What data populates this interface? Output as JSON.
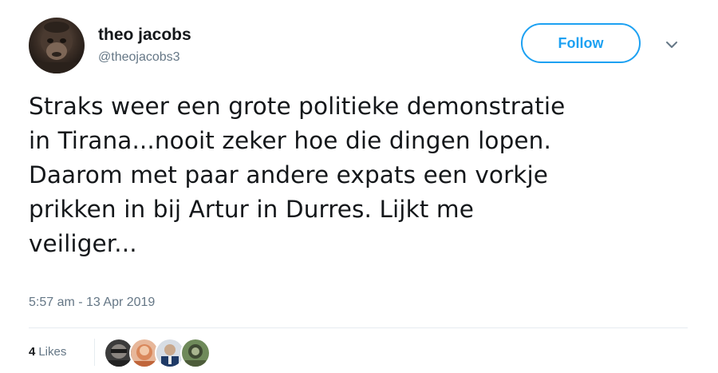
{
  "user": {
    "display_name": "theo jacobs",
    "handle": "@theojacobs3",
    "avatar_icon": "monkey-avatar-icon"
  },
  "actions": {
    "follow_label": "Follow",
    "more_icon": "chevron-down-icon"
  },
  "tweet": {
    "lines": [
      "Straks weer een grote politieke demonstratie",
      "in Tirana...nooit zeker hoe die dingen lopen.",
      "Daarom met paar andere expats een vorkje",
      "prikken in bij Artur in Durres. Lijkt me",
      "veiliger..."
    ]
  },
  "timestamp": "5:57 am - 13 Apr 2019",
  "stats": {
    "likes_count": "4",
    "likes_label": "Likes"
  },
  "colors": {
    "accent": "#1da1f2",
    "text_primary": "#14171a",
    "text_secondary": "#657786",
    "divider": "#e6ecf0"
  }
}
